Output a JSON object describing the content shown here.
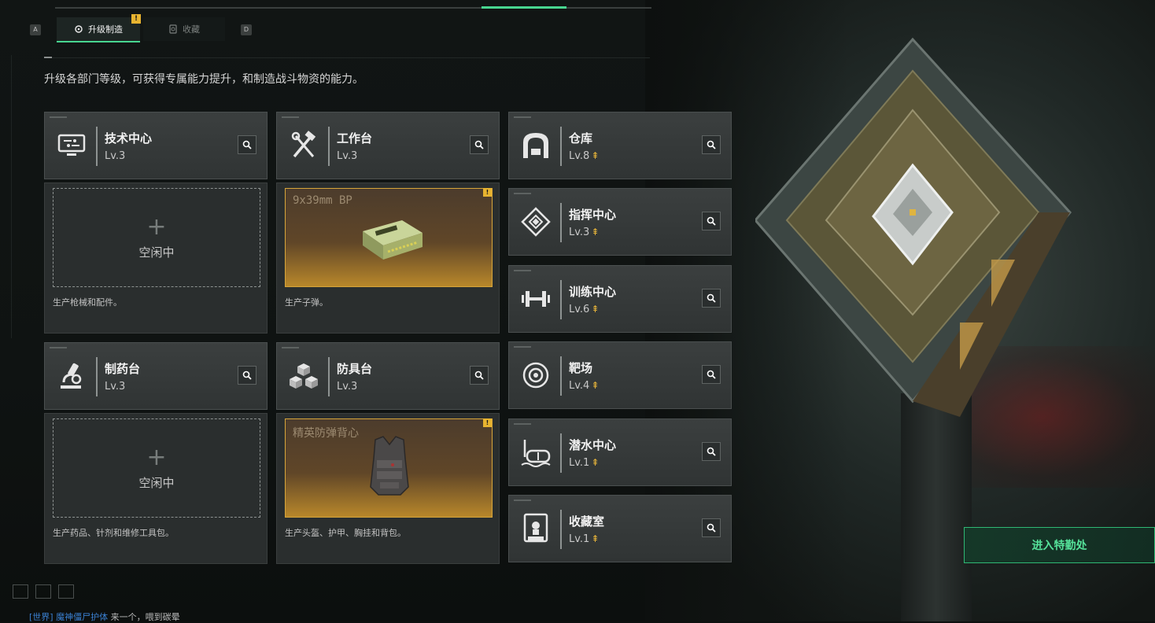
{
  "top_nav": {
    "key_left": "A",
    "key_right": "D",
    "tabs": [
      {
        "label": "升级制造",
        "active": true,
        "badge": "!"
      },
      {
        "label": "收藏",
        "active": false
      }
    ]
  },
  "subtitle": "升级各部门等级，可获得专属能力提升，和制造战斗物资的能力。",
  "stations": [
    {
      "name": "技术中心",
      "level": "Lv.3",
      "icon": "computer-icon"
    },
    {
      "name": "工作台",
      "level": "Lv.3",
      "icon": "tools-icon"
    },
    {
      "name": "制药台",
      "level": "Lv.3",
      "icon": "microscope-icon"
    },
    {
      "name": "防具台",
      "level": "Lv.3",
      "icon": "cubes-icon"
    }
  ],
  "panels": [
    {
      "status": "空闲中",
      "desc": "生产枪械和配件。"
    },
    {
      "product": "9x39mm BP",
      "badge": "!",
      "desc": "生产子弹。"
    },
    {
      "status": "空闲中",
      "desc": "生产药品、针剂和维修工具包。"
    },
    {
      "product": "精英防弹背心",
      "badge": "!",
      "desc": "生产头盔、护甲、胸挂和背包。"
    }
  ],
  "departments": [
    {
      "name": "仓库",
      "level": "Lv.8",
      "upgradable": true,
      "icon": "warehouse-icon"
    },
    {
      "name": "指挥中心",
      "level": "Lv.3",
      "upgradable": true,
      "icon": "command-icon"
    },
    {
      "name": "训练中心",
      "level": "Lv.6",
      "upgradable": true,
      "icon": "dumbbell-icon"
    },
    {
      "name": "靶场",
      "level": "Lv.4",
      "upgradable": true,
      "icon": "target-icon"
    },
    {
      "name": "潜水中心",
      "level": "Lv.1",
      "upgradable": true,
      "icon": "diving-mask-icon"
    },
    {
      "name": "收藏室",
      "level": "Lv.1",
      "upgradable": true,
      "icon": "display-case-icon"
    }
  ],
  "enter_button": "进入特勤处",
  "chat": {
    "channel": "[世界]",
    "user": "魔神僵尸护体",
    "message": "来一个，喂到碳晕"
  },
  "colors": {
    "accent_green": "#48d690",
    "badge_gold": "#e8b430",
    "production_gold": "#d7a53a"
  }
}
